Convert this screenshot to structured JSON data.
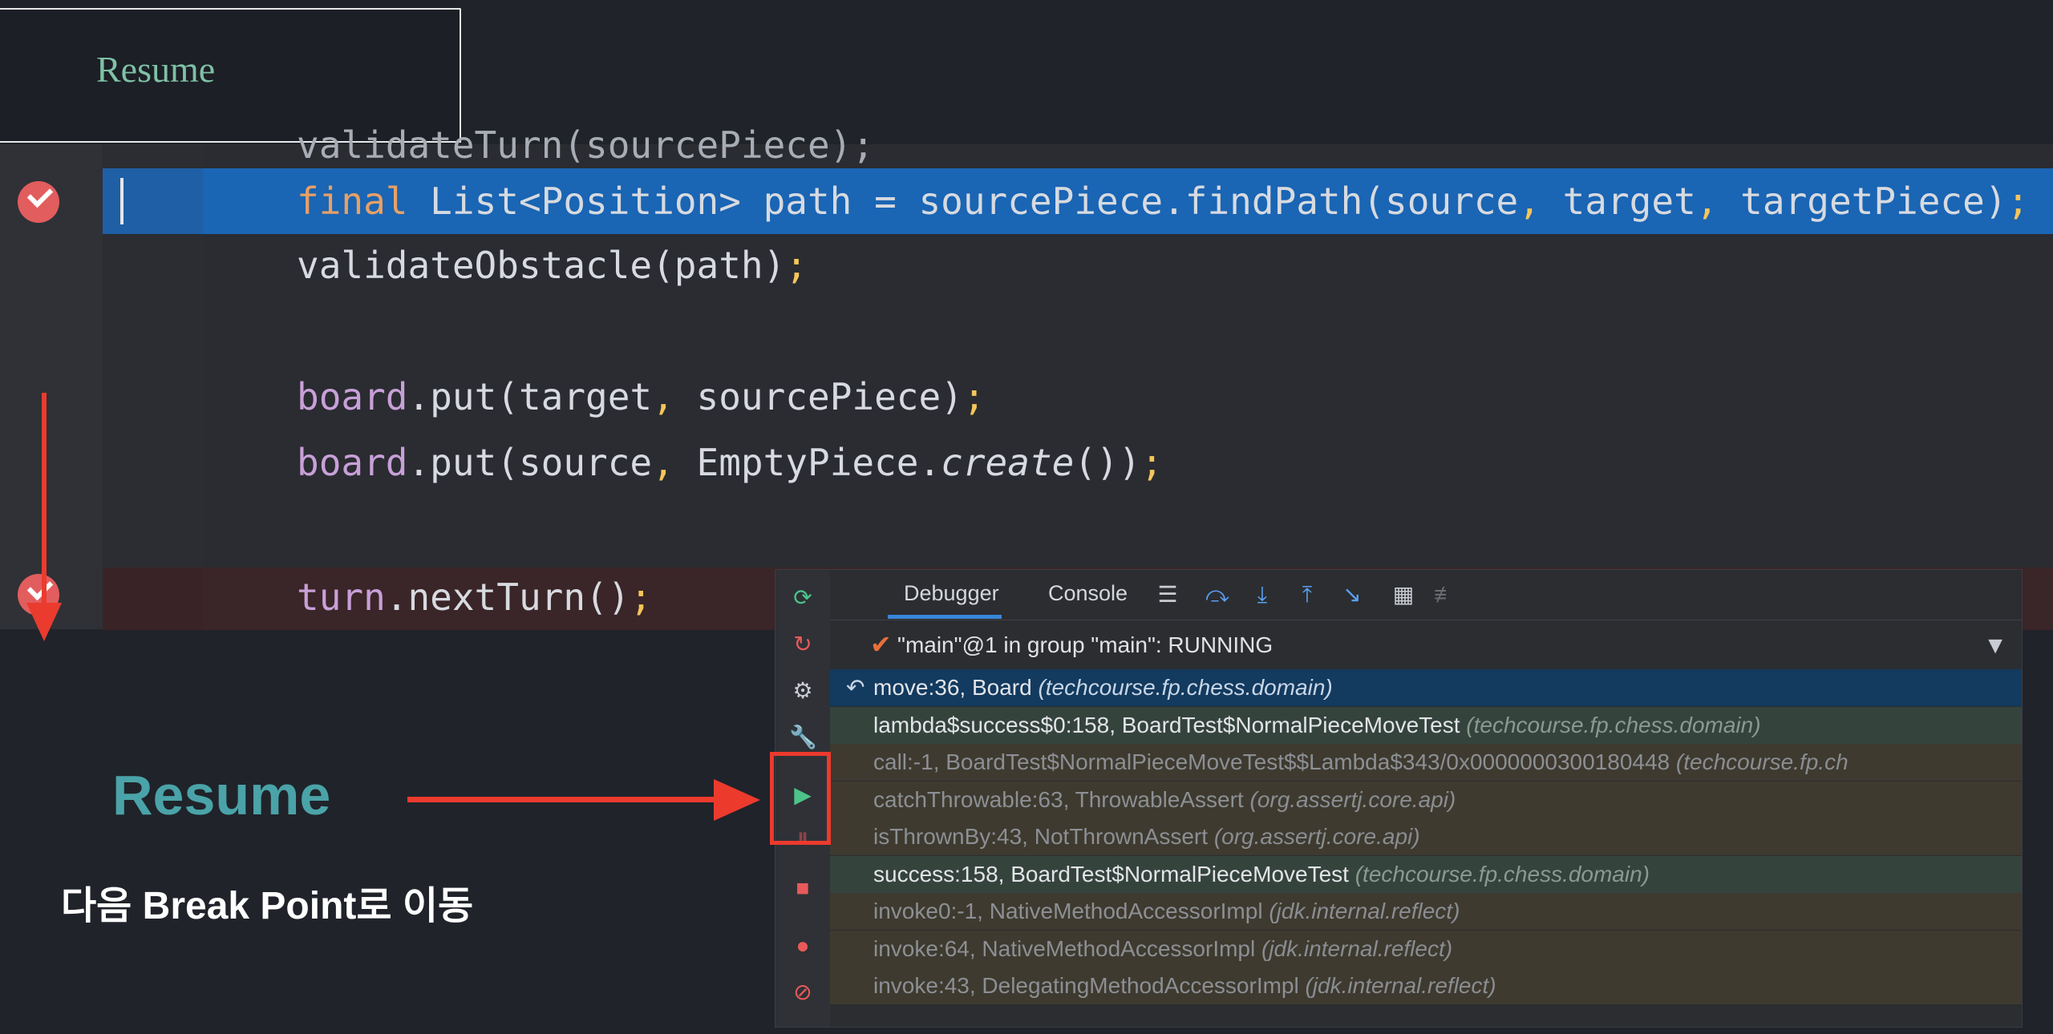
{
  "title_card": {
    "text": "Resume"
  },
  "code": {
    "line0": "validateTurn(sourcePiece);",
    "line1": [
      {
        "t": "final",
        "c": "kw"
      },
      {
        "t": " List<Position> path = sourcePiece.findPath(source",
        "c": ""
      },
      {
        "t": ",",
        "c": "pn"
      },
      {
        "t": " target",
        "c": ""
      },
      {
        "t": ",",
        "c": "pn"
      },
      {
        "t": " targetPiece)",
        "c": ""
      },
      {
        "t": ";",
        "c": "pn"
      }
    ],
    "line2": [
      {
        "t": "validateObstacle(path)",
        "c": ""
      },
      {
        "t": ";",
        "c": "pn"
      }
    ],
    "line4": [
      {
        "t": "board",
        "c": "fld"
      },
      {
        "t": ".put(target",
        "c": ""
      },
      {
        "t": ",",
        "c": "pn"
      },
      {
        "t": " sourcePiece)",
        "c": ""
      },
      {
        "t": ";",
        "c": "pn"
      }
    ],
    "line5": [
      {
        "t": "board",
        "c": "fld"
      },
      {
        "t": ".put(source",
        "c": ""
      },
      {
        "t": ",",
        "c": "pn"
      },
      {
        "t": " EmptyPiece.",
        "c": ""
      },
      {
        "t": "create",
        "c": "it"
      },
      {
        "t": "())",
        "c": ""
      },
      {
        "t": ";",
        "c": "pn"
      }
    ],
    "line7": [
      {
        "t": "turn",
        "c": "fld"
      },
      {
        "t": ".nextTurn()",
        "c": ""
      },
      {
        "t": ";",
        "c": "pn"
      }
    ]
  },
  "debugger": {
    "tabs": {
      "debugger": "Debugger",
      "console": "Console"
    },
    "thread": "\"main\"@1 in group \"main\": RUNNING",
    "frames": [
      {
        "name": "move:36, Board",
        "pkg": "(techcourse.fp.chess.domain)",
        "style": "sel"
      },
      {
        "name": "lambda$success$0:158, BoardTest$NormalPieceMoveTest",
        "pkg": "(techcourse.fp.chess.domain)",
        "style": "grn"
      },
      {
        "name": "call:-1, BoardTest$NormalPieceMoveTest$$Lambda$343/0x0000000300180448",
        "pkg": "(techcourse.fp.ch",
        "style": "lib"
      },
      {
        "name": "catchThrowable:63, ThrowableAssert",
        "pkg": "(org.assertj.core.api)",
        "style": "lib"
      },
      {
        "name": "isThrownBy:43, NotThrownAssert",
        "pkg": "(org.assertj.core.api)",
        "style": "lib"
      },
      {
        "name": "success:158, BoardTest$NormalPieceMoveTest",
        "pkg": "(techcourse.fp.chess.domain)",
        "style": "grn"
      },
      {
        "name": "invoke0:-1, NativeMethodAccessorImpl",
        "pkg": "(jdk.internal.reflect)",
        "style": "lib"
      },
      {
        "name": "invoke:64, NativeMethodAccessorImpl",
        "pkg": "(jdk.internal.reflect)",
        "style": "lib"
      },
      {
        "name": "invoke:43, DelegatingMethodAccessorImpl",
        "pkg": "(jdk.internal.reflect)",
        "style": "lib"
      }
    ]
  },
  "annotation": {
    "title": "Resume",
    "desc": "다음 Break Point로 이동"
  },
  "colors": {
    "accent": "#3a86d8",
    "highlight": "#ec3a2d",
    "resume_text": "#4aa3a8"
  }
}
